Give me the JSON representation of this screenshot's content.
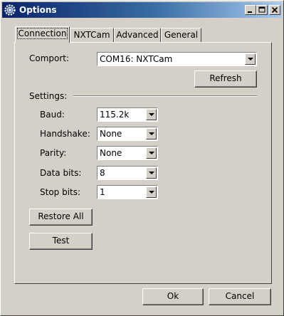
{
  "window": {
    "title": "Options"
  },
  "tabs": [
    {
      "label": "Connection"
    },
    {
      "label": "NXTCam"
    },
    {
      "label": "Advanced"
    },
    {
      "label": "General"
    }
  ],
  "connection": {
    "comport": {
      "label": "Comport:",
      "value": "COM16: NXTCam"
    },
    "refresh_label": "Refresh",
    "settings_label": "Settings:",
    "baud": {
      "label": "Baud:",
      "value": "115.2k"
    },
    "handshake": {
      "label": "Handshake:",
      "value": "None"
    },
    "parity": {
      "label": "Parity:",
      "value": "None"
    },
    "data_bits": {
      "label": "Data bits:",
      "value": "8"
    },
    "stop_bits": {
      "label": "Stop bits:",
      "value": "1"
    },
    "restore_all_label": "Restore All",
    "test_label": "Test"
  },
  "footer": {
    "ok_label": "Ok",
    "cancel_label": "Cancel"
  }
}
